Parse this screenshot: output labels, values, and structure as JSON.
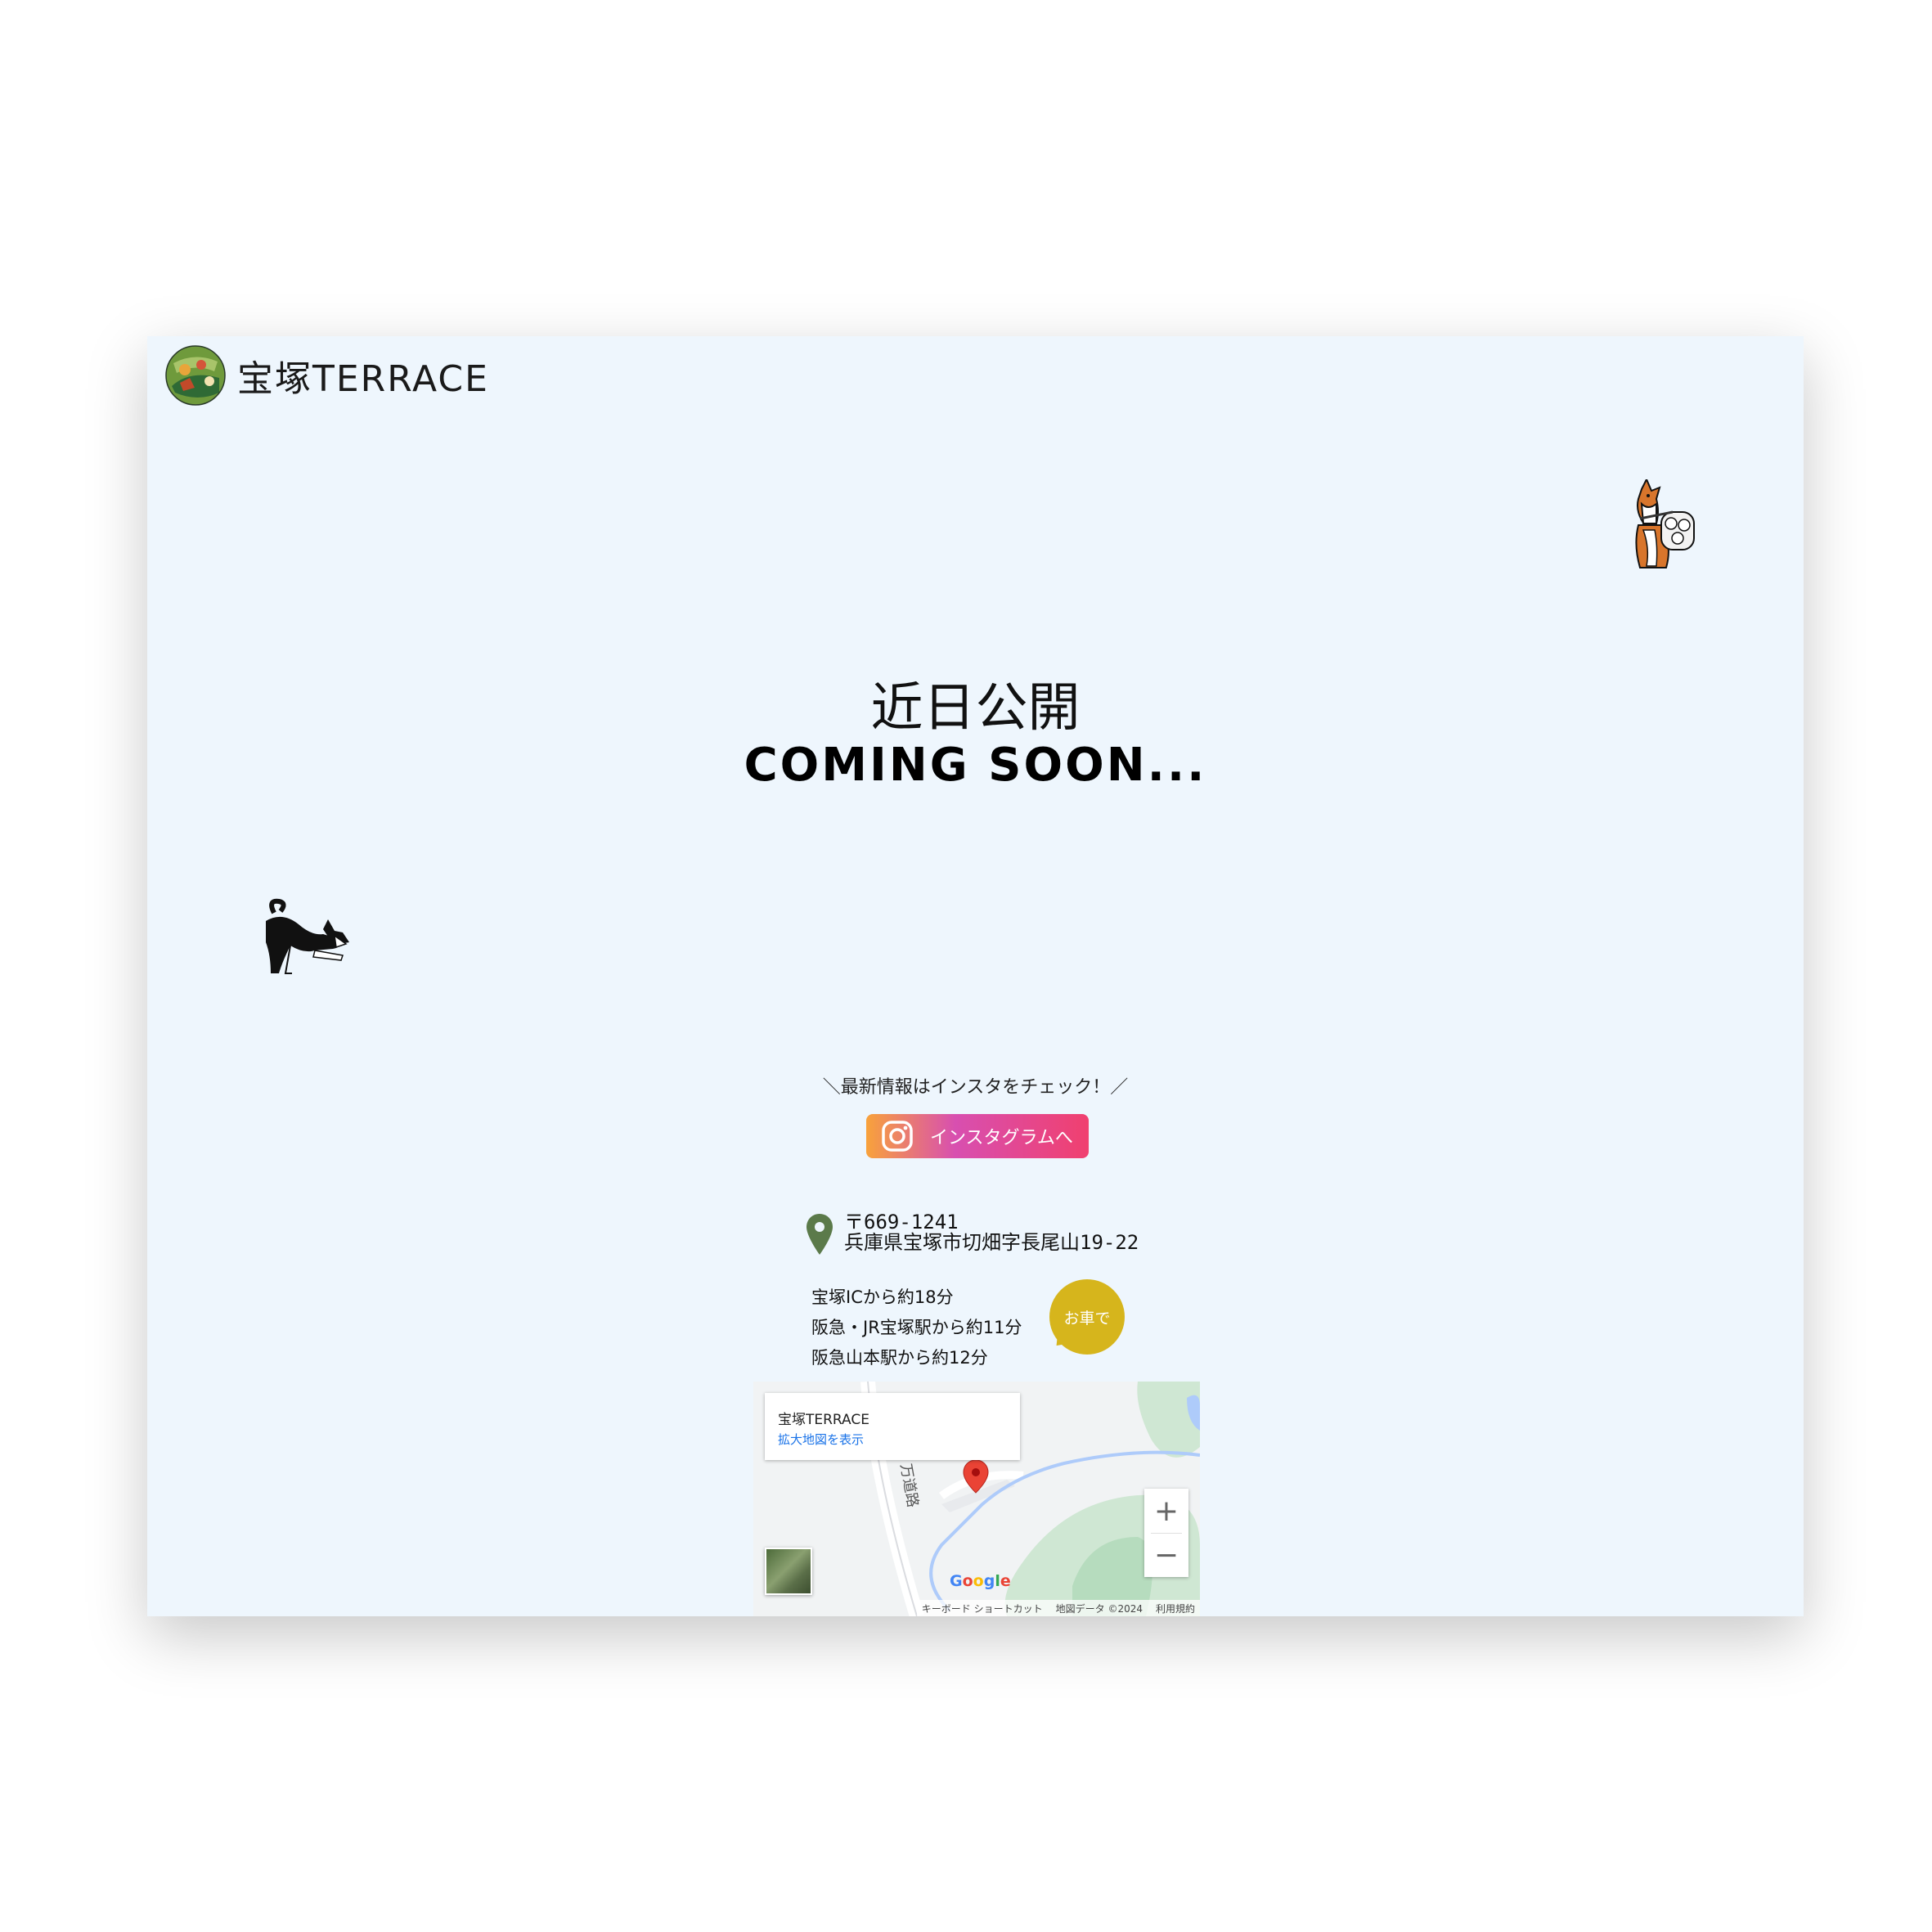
{
  "header": {
    "logo_text": "宝塚TERRACE"
  },
  "hero": {
    "title_ja": "近日公開",
    "title_en": "COMING SOON..."
  },
  "instagram": {
    "cta_text": "＼最新情報はインスタをチェック！／",
    "button_label": "インスタグラムへ"
  },
  "address": {
    "postal": "〒669-1241",
    "street": "兵庫県宝塚市切畑字長尾山19-22"
  },
  "access": {
    "lines": [
      "宝塚ICから約18分",
      "阪急・JR宝塚駅から約11分",
      "阪急山本駅から約12分"
    ],
    "badge": "お車で"
  },
  "map": {
    "place_name": "宝塚TERRACE",
    "larger_map_link": "拡大地図を表示",
    "road_label": "万道路",
    "zoom_in": "+",
    "zoom_out": "−",
    "google": [
      "G",
      "o",
      "o",
      "g",
      "l",
      "e"
    ],
    "attribution": {
      "shortcuts": "キーボード ショートカット",
      "data": "地図データ ©2024",
      "terms": "利用規約"
    }
  },
  "colors": {
    "page_bg": "#eef6fd",
    "badge": "#d6b51c",
    "pin": "#5b7a4a",
    "map_pin": "#ea4335"
  },
  "icons": [
    "logo-emblem-icon",
    "shiba-sitting-icon",
    "shiba-stretching-icon",
    "instagram-icon",
    "location-pin-icon",
    "map-marker-icon"
  ]
}
